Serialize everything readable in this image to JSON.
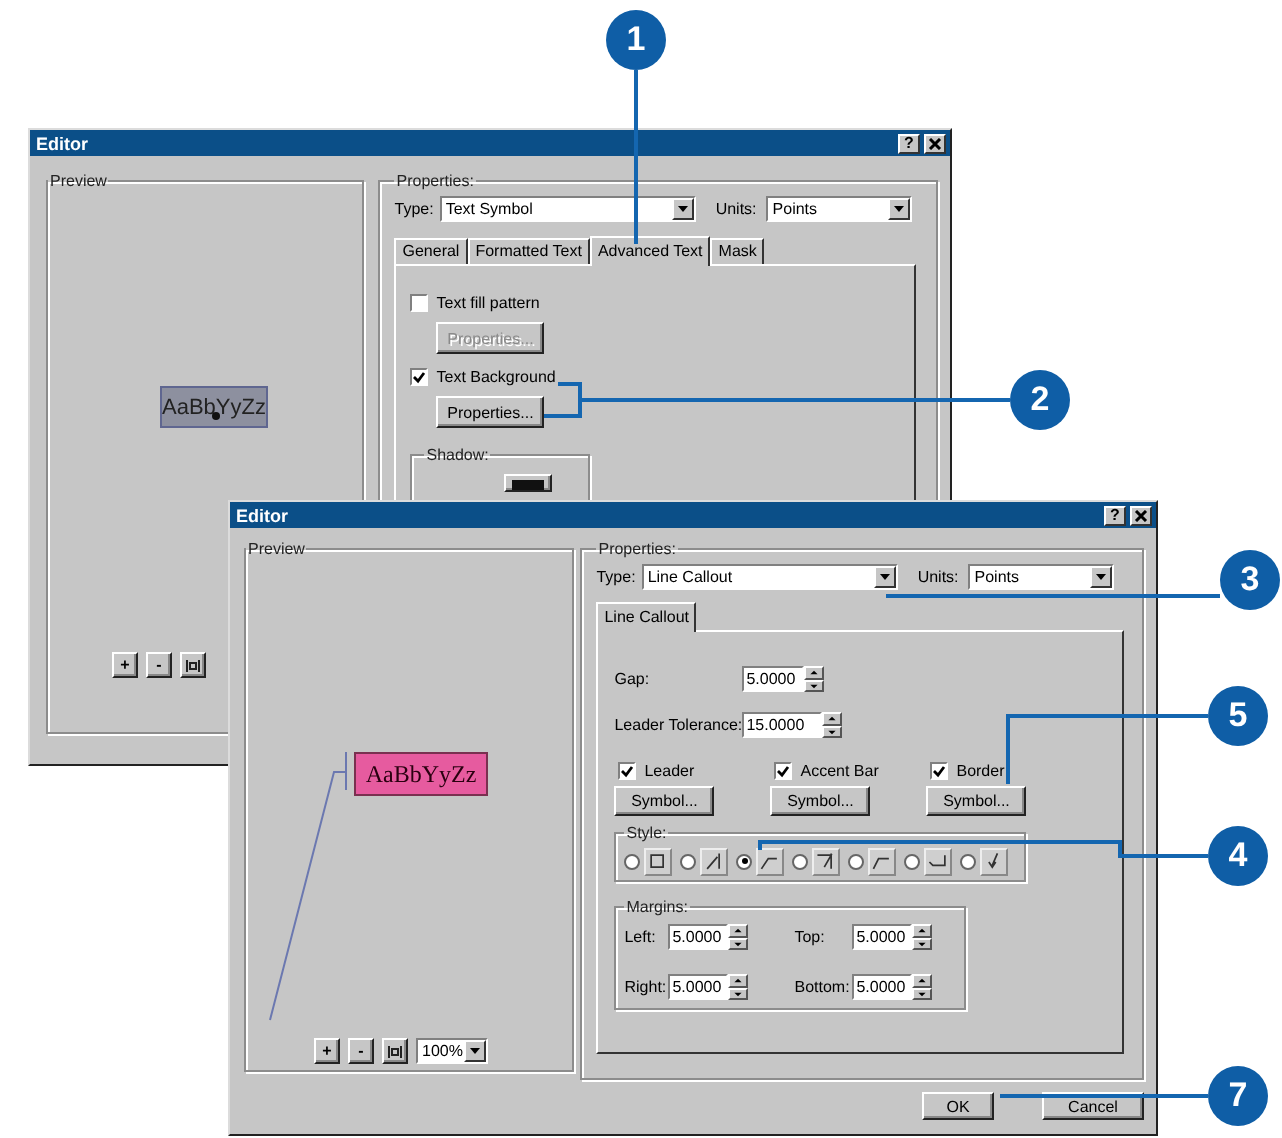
{
  "back_window": {
    "title": "Editor",
    "help": "?",
    "preview": {
      "label": "Preview",
      "sample": "AaBbYyZz",
      "zoom_buttons": [
        "+",
        "-"
      ]
    },
    "properties": {
      "label": "Properties:",
      "type_label": "Type:",
      "type_value": "Text Symbol",
      "units_label": "Units:",
      "units_value": "Points",
      "tabs": [
        {
          "label": "General",
          "selected": false
        },
        {
          "label": "Formatted Text",
          "selected": false
        },
        {
          "label": "Advanced Text",
          "selected": true
        },
        {
          "label": "Mask",
          "selected": false
        }
      ],
      "options": [
        {
          "label": "Text fill pattern",
          "checked": false,
          "button": "Properties...",
          "disabled": true
        },
        {
          "label": "Text Background",
          "checked": true,
          "button": "Properties...",
          "disabled": false
        }
      ],
      "shadow_label": "Shadow:"
    }
  },
  "front_window": {
    "title": "Editor",
    "help": "?",
    "preview": {
      "label": "Preview",
      "sample": "AaBbYyZz",
      "zoom_buttons": [
        "+",
        "-"
      ],
      "zoom_value": "100%"
    },
    "properties": {
      "label": "Properties:",
      "type_label": "Type:",
      "type_value": "Line Callout",
      "units_label": "Units:",
      "units_value": "Points",
      "tabs": [
        {
          "label": "Line Callout",
          "selected": true
        }
      ],
      "fields": [
        {
          "label": "Gap:",
          "value": "5.0000"
        },
        {
          "label": "Leader Tolerance:",
          "value": "15.0000"
        }
      ],
      "toggles": [
        {
          "label": "Leader",
          "checked": true,
          "button": "Symbol..."
        },
        {
          "label": "Accent Bar",
          "checked": true,
          "button": "Symbol..."
        },
        {
          "label": "Border",
          "checked": true,
          "button": "Symbol..."
        }
      ],
      "style": {
        "label": "Style:",
        "options": [
          {
            "selected": false
          },
          {
            "selected": false
          },
          {
            "selected": true
          },
          {
            "selected": false
          },
          {
            "selected": false
          },
          {
            "selected": false
          },
          {
            "selected": false
          }
        ]
      },
      "margins": {
        "label": "Margins:",
        "fields": [
          {
            "label": "Left:",
            "value": "5.0000"
          },
          {
            "label": "Top:",
            "value": "5.0000"
          },
          {
            "label": "Right:",
            "value": "5.0000"
          },
          {
            "label": "Bottom:",
            "value": "5.0000"
          }
        ]
      }
    },
    "buttons": [
      "OK",
      "Cancel"
    ]
  },
  "callouts": [
    {
      "number": "1"
    },
    {
      "number": "2"
    },
    {
      "number": "3"
    },
    {
      "number": "5"
    },
    {
      "number": "4"
    },
    {
      "number": "7"
    }
  ]
}
